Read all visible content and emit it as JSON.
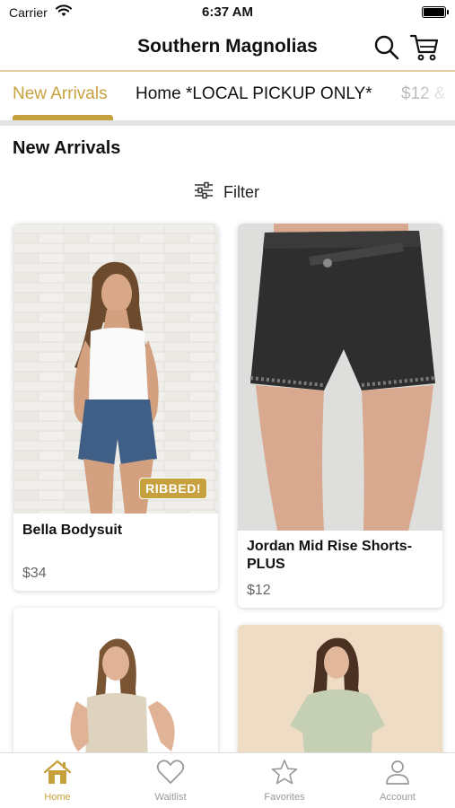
{
  "status_bar": {
    "carrier": "Carrier",
    "time": "6:37 AM"
  },
  "header": {
    "title": "Southern Magnolias"
  },
  "category_tabs": [
    {
      "label": "New Arrivals",
      "active": true
    },
    {
      "label": "Home *LOCAL PICKUP ONLY*",
      "active": false
    },
    {
      "label": "$12 &",
      "active": false
    }
  ],
  "section": {
    "title": "New Arrivals"
  },
  "filter": {
    "label": "Filter"
  },
  "products": [
    {
      "name": "Bella Bodysuit",
      "price": "$34",
      "badge": "RIBBED!"
    },
    {
      "name": "Jordan Mid Rise Shorts-PLUS",
      "price": "$12"
    }
  ],
  "tab_bar": [
    {
      "label": "Home",
      "icon": "home-icon",
      "active": true
    },
    {
      "label": "Waitlist",
      "icon": "heart-icon",
      "active": false
    },
    {
      "label": "Favorites",
      "icon": "star-icon",
      "active": false
    },
    {
      "label": "Account",
      "icon": "person-icon",
      "active": false
    }
  ],
  "colors": {
    "accent": "#c8a13f",
    "divider": "#e2cfa2"
  }
}
